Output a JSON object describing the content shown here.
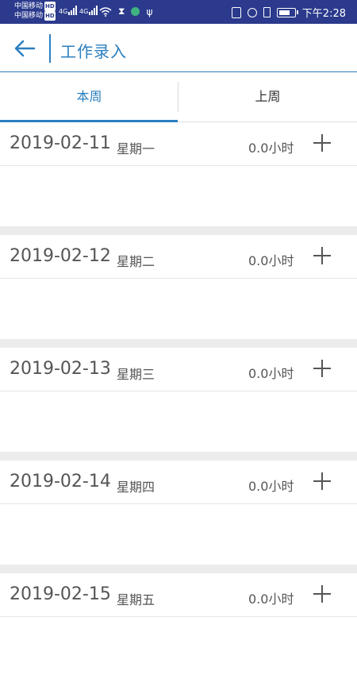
{
  "status_bar": {
    "carrier1": "中国移动",
    "carrier2": "中国移动",
    "hd": "HD",
    "net1": "4G",
    "net2": "4G",
    "time": "下午2:28"
  },
  "header": {
    "title": "工作录入"
  },
  "tabs": [
    {
      "label": "本周",
      "active": true
    },
    {
      "label": "上周",
      "active": false
    }
  ],
  "days": [
    {
      "date": "2019-02-11",
      "weekday": "星期一",
      "hours": "0.0小时"
    },
    {
      "date": "2019-02-12",
      "weekday": "星期二",
      "hours": "0.0小时"
    },
    {
      "date": "2019-02-13",
      "weekday": "星期三",
      "hours": "0.0小时"
    },
    {
      "date": "2019-02-14",
      "weekday": "星期四",
      "hours": "0.0小时"
    },
    {
      "date": "2019-02-15",
      "weekday": "星期五",
      "hours": "0.0小时"
    }
  ],
  "colors": {
    "status_bar_bg": "#2b3a8c",
    "accent": "#2b7fbf"
  }
}
